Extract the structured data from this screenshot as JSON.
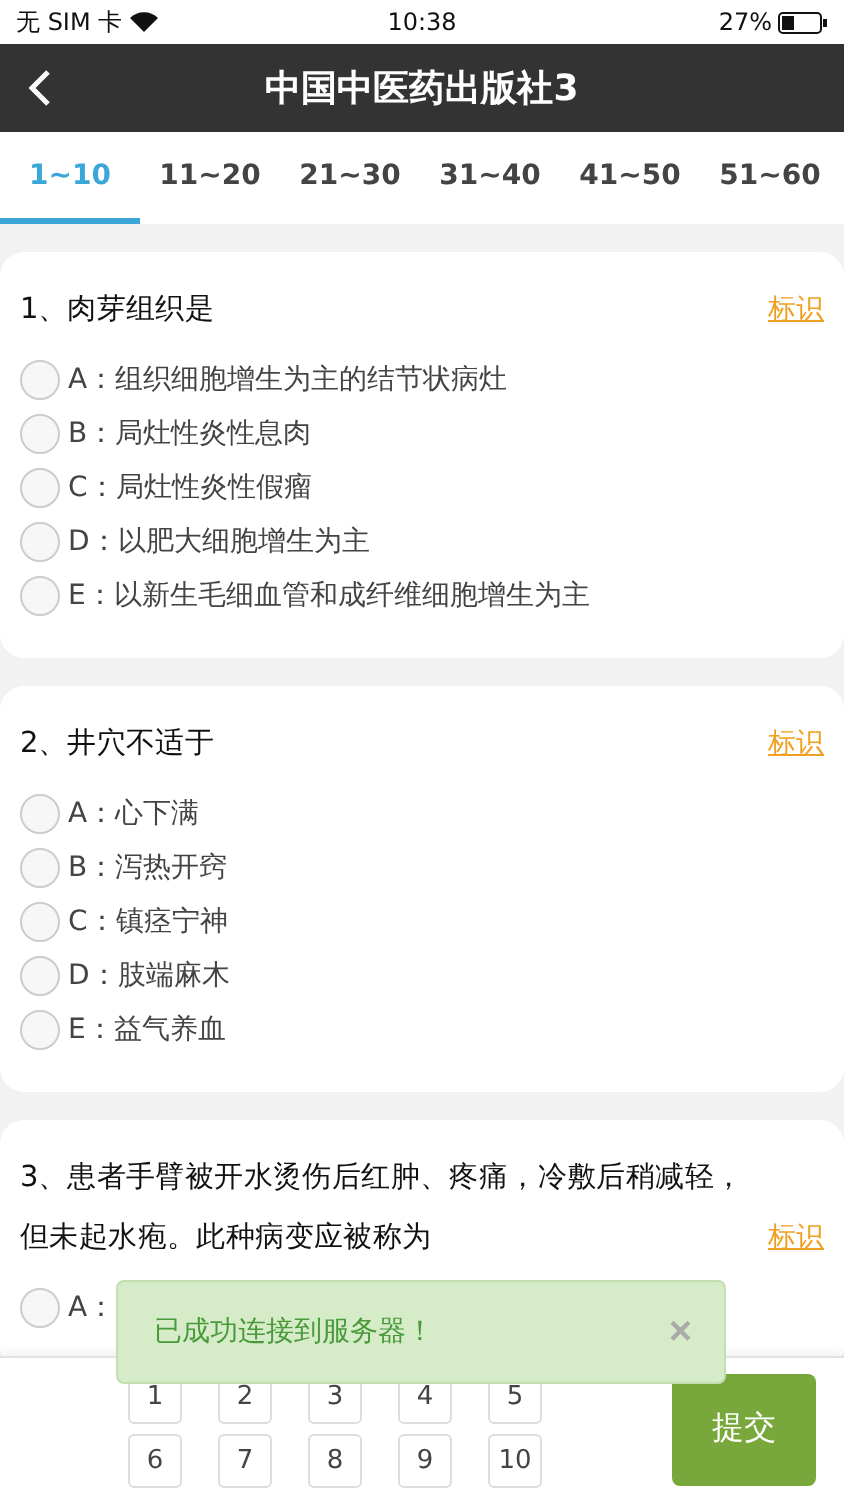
{
  "status_bar": {
    "carrier": "无 SIM 卡",
    "time": "10:38",
    "battery": "27%"
  },
  "nav": {
    "title": "中国中医药出版社3"
  },
  "tabs": [
    {
      "label": "1~10",
      "selected": true
    },
    {
      "label": "11~20",
      "selected": false
    },
    {
      "label": "21~30",
      "selected": false
    },
    {
      "label": "31~40",
      "selected": false
    },
    {
      "label": "41~50",
      "selected": false
    },
    {
      "label": "51~60",
      "selected": false
    }
  ],
  "questions": [
    {
      "title": "1、肉芽组织是",
      "mark_link": "标识",
      "options": [
        {
          "label": "A：组织细胞增生为主的结节状病灶",
          "selected": false
        },
        {
          "label": "B：局灶性炎性息肉",
          "selected": false
        },
        {
          "label": "C：局灶性炎性假瘤",
          "selected": false
        },
        {
          "label": "D：以肥大细胞增生为主",
          "selected": false
        },
        {
          "label": "E：以新生毛细血管和成纤维细胞增生为主",
          "selected": false
        }
      ]
    },
    {
      "title": "2、井穴不适于",
      "mark_link": "标识",
      "options": [
        {
          "label": "A：心下满",
          "selected": false
        },
        {
          "label": "B：泻热开窍",
          "selected": false
        },
        {
          "label": "C：镇痉宁神",
          "selected": false
        },
        {
          "label": "D：肢端麻木",
          "selected": false
        },
        {
          "label": "E：益气养血",
          "selected": false
        }
      ]
    },
    {
      "title": "3、患者手臂被开水烫伤后红肿、疼痛，冷敷后稍减轻，但未起水疱。此种病变应被称为",
      "mark_link": "标识",
      "options": [
        {
          "label": "A：",
          "selected": false
        }
      ]
    }
  ],
  "answer_grid": [
    "1",
    "2",
    "3",
    "4",
    "5",
    "6",
    "7",
    "8",
    "9",
    "10"
  ],
  "submit": "提交",
  "toast": {
    "message": "已成功连接到服务器！",
    "close": "×"
  }
}
